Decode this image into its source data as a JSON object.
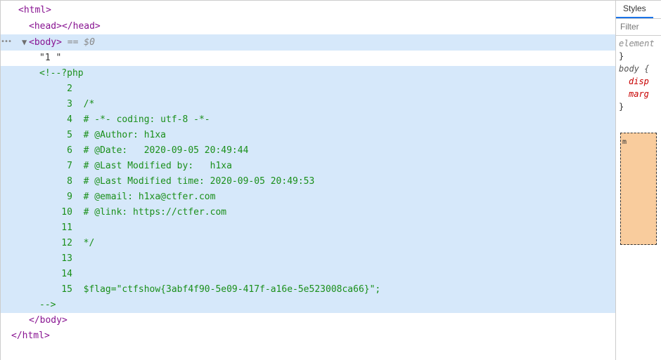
{
  "dom": {
    "html_open": "<html>",
    "head": "<head></head>",
    "body_open": "<body>",
    "body_marker": " == $0",
    "text_node": "\"1 \"",
    "comment_open": "<!--?php",
    "lines": [
      {
        "n": "2",
        "c": ""
      },
      {
        "n": "3",
        "c": "/*"
      },
      {
        "n": "4",
        "c": "# -*- coding: utf-8 -*-"
      },
      {
        "n": "5",
        "c": "# @Author: h1xa"
      },
      {
        "n": "6",
        "c": "# @Date:   2020-09-05 20:49:44"
      },
      {
        "n": "7",
        "c": "# @Last Modified by:   h1xa"
      },
      {
        "n": "8",
        "c": "# @Last Modified time: 2020-09-05 20:49:53"
      },
      {
        "n": "9",
        "c": "# @email: h1xa@ctfer.com"
      },
      {
        "n": "10",
        "c": "# @link: https://ctfer.com"
      },
      {
        "n": "11",
        "c": ""
      },
      {
        "n": "12",
        "c": "*/"
      },
      {
        "n": "13",
        "c": ""
      },
      {
        "n": "14",
        "c": ""
      },
      {
        "n": "15",
        "c": "$flag=\"ctfshow{3abf4f90-5e09-417f-a16e-5e523008ca66}\";"
      }
    ],
    "comment_close": "-->",
    "body_close": "</body>",
    "html_close": "</html>"
  },
  "styles": {
    "tab": "Styles",
    "filter_placeholder": "Filter",
    "rule1_selector": "element",
    "rule2_selector": "body {",
    "rule2_prop1": "disp",
    "rule2_prop2": "marg",
    "brace_close": "}",
    "box_label": "m"
  }
}
